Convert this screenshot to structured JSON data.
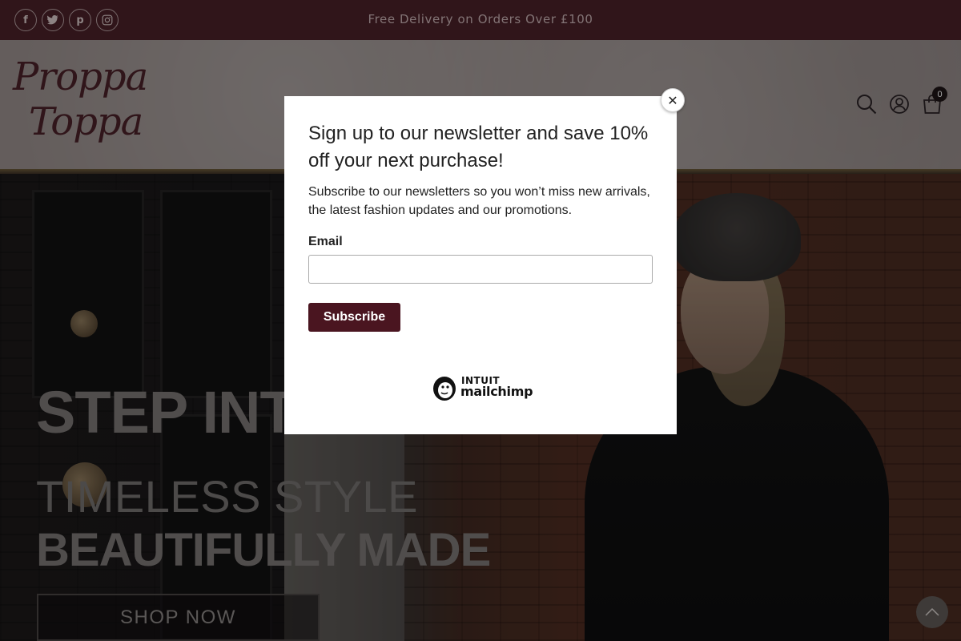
{
  "topbar": {
    "announcement": "Free Delivery on Orders Over £100",
    "social": [
      {
        "icon": "facebook-icon",
        "glyph": "f"
      },
      {
        "icon": "twitter-icon",
        "glyph": "t"
      },
      {
        "icon": "pinterest-icon",
        "glyph": "p"
      },
      {
        "icon": "instagram-icon",
        "glyph": "◎"
      }
    ]
  },
  "header": {
    "logo_line1": "Proppa",
    "logo_line2": "Toppa",
    "cart_count": "0",
    "icons": [
      "search-icon",
      "account-icon",
      "cart-icon"
    ]
  },
  "hero": {
    "headline": "STEP INTO",
    "line2": "TIMELESS STYLE",
    "line3": "BEAUTIFULLY MADE",
    "cta_label": "SHOP NOW"
  },
  "modal": {
    "close_glyph": "✕",
    "title": "Sign up to our newsletter and save 10% off your next purchase!",
    "subtitle": "Subscribe to our newsletters so you won’t miss new arrivals, the latest fashion updates and our promotions.",
    "email_label": "Email",
    "email_value": "",
    "submit_label": "Subscribe",
    "brand_top": "INTUIT",
    "brand_word": "mailchimp"
  },
  "colors": {
    "topbar_bg": "#4a2128",
    "brand": "#4a2128",
    "button": "#4a1520"
  }
}
